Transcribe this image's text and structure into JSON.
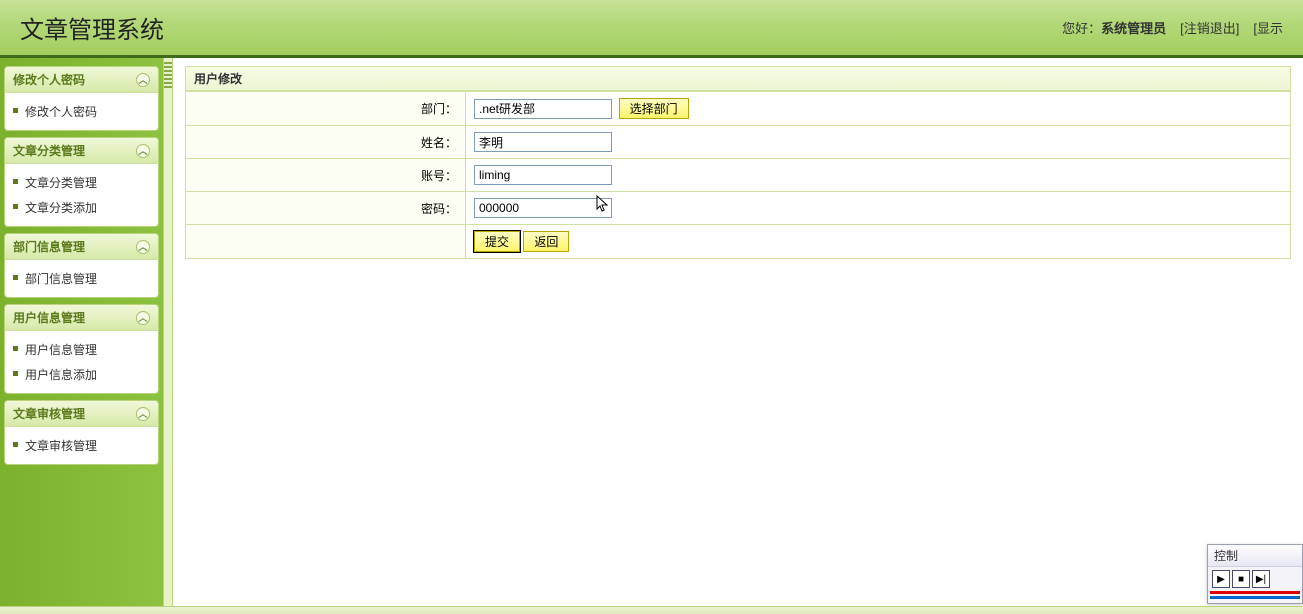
{
  "header": {
    "title": "文章管理系统",
    "greeting_prefix": "您好：",
    "user": "系统管理员",
    "logout_link": "[注销退出]",
    "show_link": "[显示"
  },
  "sidebar": [
    {
      "title": "修改个人密码",
      "items": [
        "修改个人密码"
      ]
    },
    {
      "title": "文章分类管理",
      "items": [
        "文章分类管理",
        "文章分类添加"
      ]
    },
    {
      "title": "部门信息管理",
      "items": [
        "部门信息管理"
      ]
    },
    {
      "title": "用户信息管理",
      "items": [
        "用户信息管理",
        "用户信息添加"
      ]
    },
    {
      "title": "文章审核管理",
      "items": [
        "文章审核管理"
      ]
    }
  ],
  "main": {
    "panel_title": "用户修改",
    "fields": {
      "department_label": "部门：",
      "department_value": ".net研发部",
      "department_button": "选择部门",
      "name_label": "姓名：",
      "name_value": "李明",
      "account_label": "账号：",
      "account_value": "liming",
      "password_label": "密码：",
      "password_value": "000000"
    },
    "buttons": {
      "submit": "提交",
      "back": "返回"
    }
  },
  "float_control": {
    "title": "控制"
  }
}
